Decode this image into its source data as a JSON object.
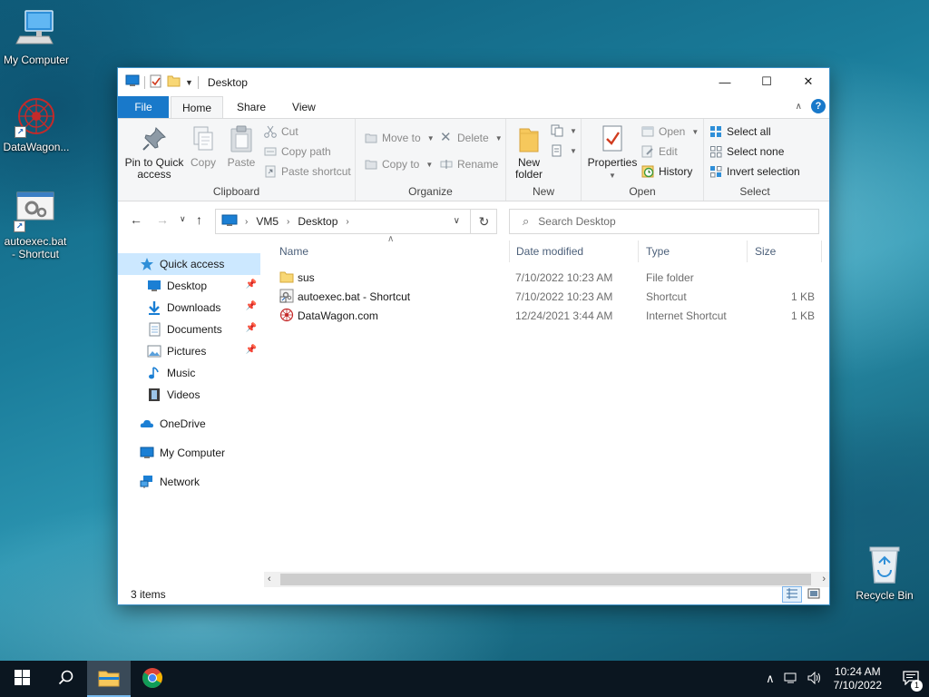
{
  "desktop": {
    "icons": [
      {
        "label": "My Computer"
      },
      {
        "label": "DataWagon..."
      },
      {
        "label": "autoexec.bat\n- Shortcut"
      },
      {
        "label": "Recycle Bin"
      }
    ]
  },
  "window": {
    "title": "Desktop",
    "controls": {
      "minimize": "—",
      "maximize": "☐",
      "close": "✕"
    }
  },
  "ribbon": {
    "tabs": [
      "File",
      "Home",
      "Share",
      "View"
    ],
    "active_tab": "Home",
    "clipboard": {
      "pin": "Pin to Quick\naccess",
      "copy": "Copy",
      "paste": "Paste",
      "cut": "Cut",
      "copy_path": "Copy path",
      "paste_shortcut": "Paste shortcut",
      "label": "Clipboard"
    },
    "organize": {
      "move_to": "Move to",
      "copy_to": "Copy to",
      "delete": "Delete",
      "rename": "Rename",
      "label": "Organize"
    },
    "new": {
      "new_folder": "New\nfolder",
      "label": "New"
    },
    "open": {
      "properties": "Properties",
      "open": "Open",
      "edit": "Edit",
      "history": "History",
      "label": "Open"
    },
    "select": {
      "select_all": "Select all",
      "select_none": "Select none",
      "invert": "Invert selection",
      "label": "Select"
    }
  },
  "address": {
    "crumbs": [
      "VM5",
      "Desktop"
    ],
    "search_placeholder": "Search Desktop"
  },
  "navpane": {
    "items": [
      {
        "label": "Quick access",
        "icon": "star-icon",
        "selected": true
      },
      {
        "label": "Desktop",
        "icon": "desktop-icon",
        "pinned": true
      },
      {
        "label": "Downloads",
        "icon": "download-icon",
        "pinned": true
      },
      {
        "label": "Documents",
        "icon": "documents-icon",
        "pinned": true
      },
      {
        "label": "Pictures",
        "icon": "pictures-icon",
        "pinned": true
      },
      {
        "label": "Music",
        "icon": "music-icon"
      },
      {
        "label": "Videos",
        "icon": "videos-icon"
      },
      {
        "label": "OneDrive",
        "icon": "cloud-icon"
      },
      {
        "label": "My Computer",
        "icon": "computer-icon"
      },
      {
        "label": "Network",
        "icon": "network-icon"
      }
    ]
  },
  "filelist": {
    "columns": [
      "Name",
      "Date modified",
      "Type",
      "Size"
    ],
    "rows": [
      {
        "name": "sus",
        "date": "7/10/2022 10:23 AM",
        "type": "File folder",
        "size": "",
        "icon": "folder-icon"
      },
      {
        "name": "autoexec.bat - Shortcut",
        "date": "7/10/2022 10:23 AM",
        "type": "Shortcut",
        "size": "1 KB",
        "icon": "shortcut-icon"
      },
      {
        "name": "DataWagon.com",
        "date": "12/24/2021 3:44 AM",
        "type": "Internet Shortcut",
        "size": "1 KB",
        "icon": "internet-shortcut-icon"
      }
    ]
  },
  "status": {
    "item_count": "3 items"
  },
  "taskbar": {
    "time": "10:24 AM",
    "date": "7/10/2022",
    "notification_count": "1"
  },
  "colors": {
    "accent": "#1979ca",
    "selection": "#cce8ff",
    "taskbar": "#0b1620"
  }
}
